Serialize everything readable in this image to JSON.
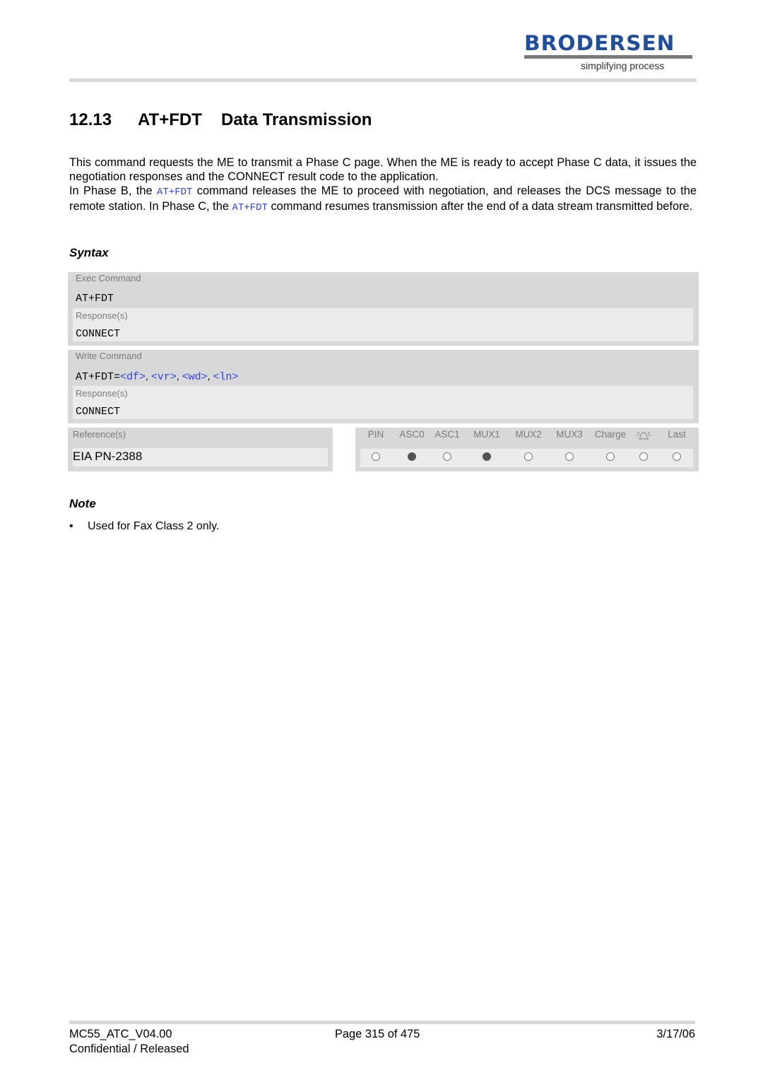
{
  "header": {
    "logo_text": "BRODERSEN",
    "logo_tagline": "simplifying process",
    "logo_color": "#1f4e9c"
  },
  "section": {
    "number": "12.13",
    "command": "AT+FDT",
    "title": "Data Transmission"
  },
  "description": {
    "line1": "This command requests the ME to transmit a Phase C page. When the ME is ready to accept Phase C data, it issues the negotiation responses and the CONNECT result code to the application.",
    "line2_pre": "In Phase B, the ",
    "line2_code": "AT+FDT",
    "line2_mid": " command releases the ME to proceed with negotiation, and releases the DCS message to the remote station. In Phase C, the ",
    "line2_code2": "AT+FDT",
    "line2_post": " command resumes transmission after the end of a data stream transmitted before."
  },
  "syntax": {
    "heading": "Syntax",
    "exec": {
      "label": "Exec Command",
      "command": "AT+FDT",
      "response_label": "Response(s)",
      "response": "CONNECT"
    },
    "write": {
      "label": "Write Command",
      "command_prefix": "AT+FDT=",
      "params": [
        "<df>",
        "<vr>",
        "<wd>",
        "<ln>"
      ],
      "separator": ", ",
      "response_label": "Response(s)",
      "response": "CONNECT"
    },
    "references": {
      "label": "Reference(s)",
      "value": "EIA PN-2388"
    },
    "matrix": {
      "columns": [
        {
          "label": "PIN",
          "active": false
        },
        {
          "label": "ASC0",
          "active": true
        },
        {
          "label": "ASC1",
          "active": false
        },
        {
          "label": "MUX1",
          "active": true
        },
        {
          "label": "MUX2",
          "active": false
        },
        {
          "label": "MUX3",
          "active": false
        },
        {
          "label": "Charge",
          "active": false
        },
        {
          "label": "alarm-clock-icon",
          "active": false
        },
        {
          "label": "Last",
          "active": false
        }
      ]
    }
  },
  "note": {
    "heading": "Note",
    "bullet_symbol": "•",
    "items": [
      "Used for Fax Class 2 only."
    ]
  },
  "footer": {
    "doc_id": "MC55_ATC_V04.00",
    "page": "Page 315 of 475",
    "date": "3/17/06",
    "status": "Confidential / Released"
  }
}
